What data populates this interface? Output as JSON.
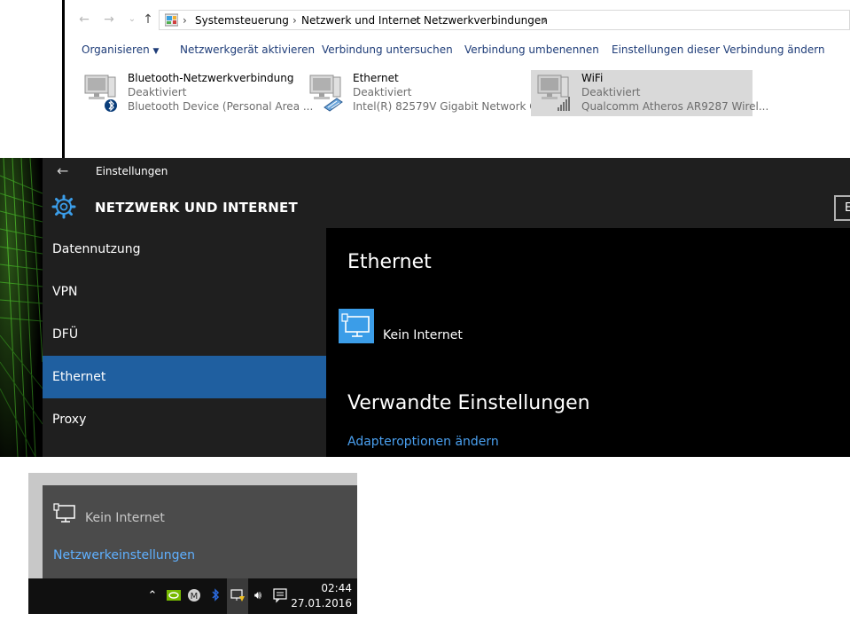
{
  "explorer": {
    "breadcrumbs": [
      "Systemsteuerung",
      "Netzwerk und Internet",
      "Netzwerkverbindungen"
    ],
    "toolbar": {
      "organize": "Organisieren",
      "enable": "Netzwerkgerät aktivieren",
      "diagnose": "Verbindung untersuchen",
      "rename": "Verbindung umbenennen",
      "change_settings": "Einstellungen dieser Verbindung ändern"
    },
    "adapters": [
      {
        "name": "Bluetooth-Netzwerkverbindung",
        "status": "Deaktiviert",
        "device": "Bluetooth Device (Personal Area ...",
        "icon": "bluetooth-adapter-icon"
      },
      {
        "name": "Ethernet",
        "status": "Deaktiviert",
        "device": "Intel(R) 82579V Gigabit Network C...",
        "icon": "ethernet-adapter-icon"
      },
      {
        "name": "WiFi",
        "status": "Deaktiviert",
        "device": "Qualcomm Atheros AR9287 Wirel...",
        "icon": "wifi-adapter-icon",
        "selected": true
      }
    ]
  },
  "settings": {
    "window_title": "Einstellungen",
    "section_title": "NETZWERK UND INTERNET",
    "search_partial": "E",
    "nav": [
      "Datennutzung",
      "VPN",
      "DFÜ",
      "Ethernet",
      "Proxy"
    ],
    "active_nav": "Ethernet",
    "content": {
      "title": "Ethernet",
      "status": "Kein Internet",
      "related_title": "Verwandte Einstellungen",
      "link": "Adapteroptionen ändern"
    },
    "accent": "#1f5fa0"
  },
  "flyout": {
    "status": "Kein Internet",
    "link": "Netzwerkeinstellungen"
  },
  "taskbar": {
    "time": "02:44",
    "date": "27.01.2016"
  }
}
